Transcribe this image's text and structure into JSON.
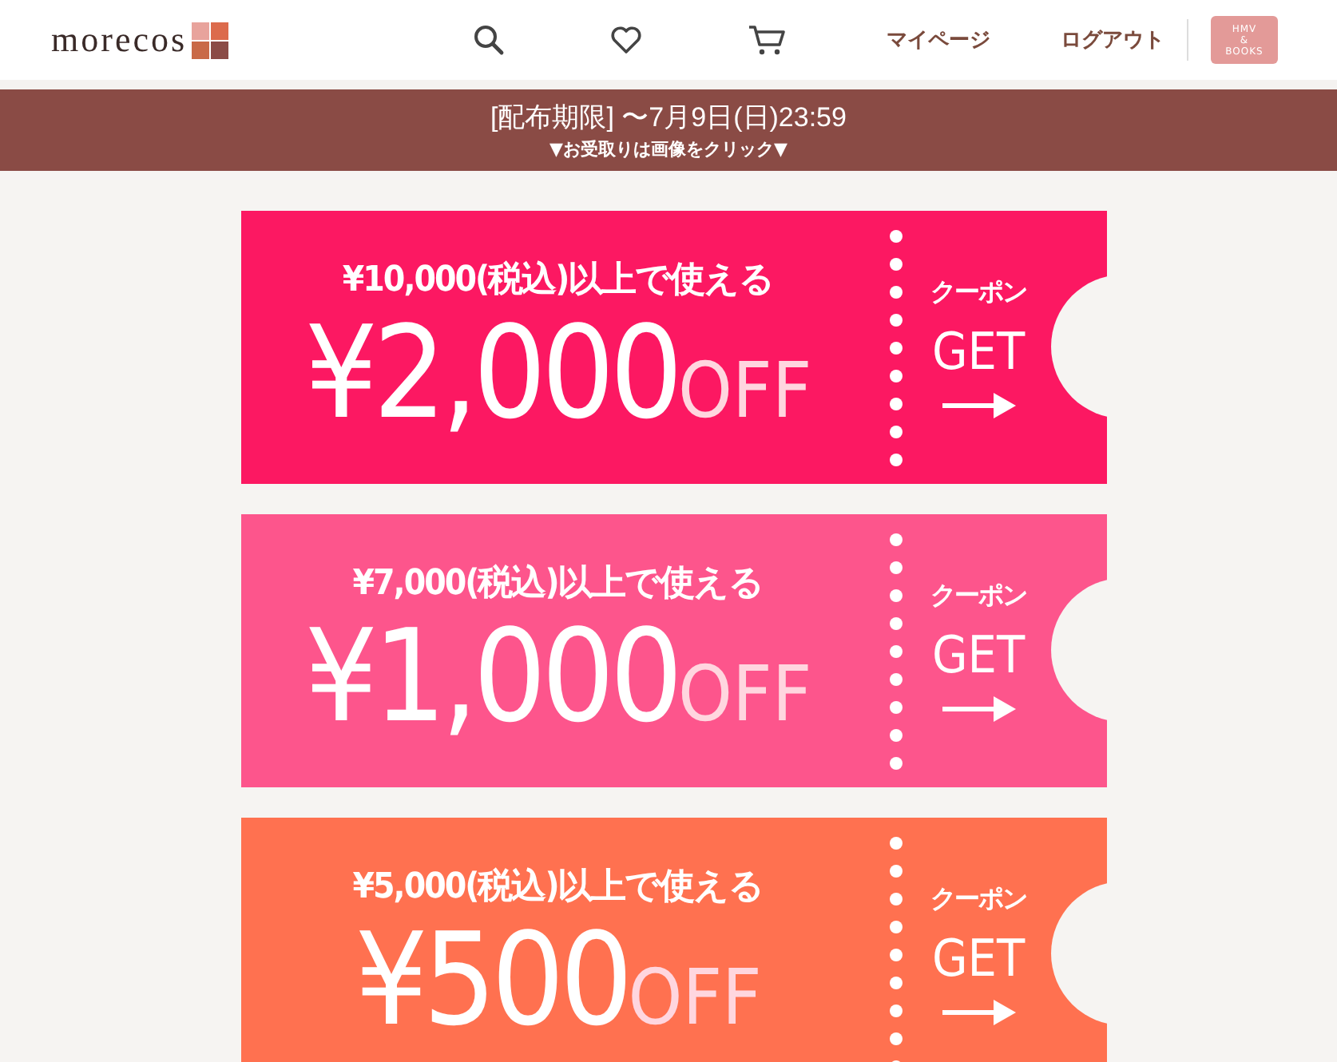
{
  "header": {
    "logo": "morecos",
    "nav": [
      {
        "kind": "search"
      },
      {
        "kind": "heart"
      },
      {
        "kind": "cart"
      }
    ],
    "links": [
      "マイページ",
      "ログアウト"
    ],
    "partner_logo": {
      "line_1": "HMV",
      "line_2": "&",
      "line_3": "BOOKS"
    }
  },
  "notice": {
    "deadline": "[配布期限] 〜7月9日(日)23:59",
    "hint": "▼お受取りは画像をクリック▼"
  },
  "coupons": [
    {
      "color": "#fc1862",
      "condition": "¥10,000(税込)以上で使える",
      "amount": "¥2,000",
      "off": "OFF",
      "label": "クーポン",
      "action": "GET"
    },
    {
      "color": "#fd558c",
      "condition": "¥7,000(税込)以上で使える",
      "amount": "¥1,000",
      "off": "OFF",
      "label": "クーポン",
      "action": "GET"
    },
    {
      "color": "#ff7150",
      "condition": "¥5,000(税込)以上で使える",
      "amount": "¥500",
      "off": "OFF",
      "label": "クーポン",
      "action": "GET"
    }
  ]
}
